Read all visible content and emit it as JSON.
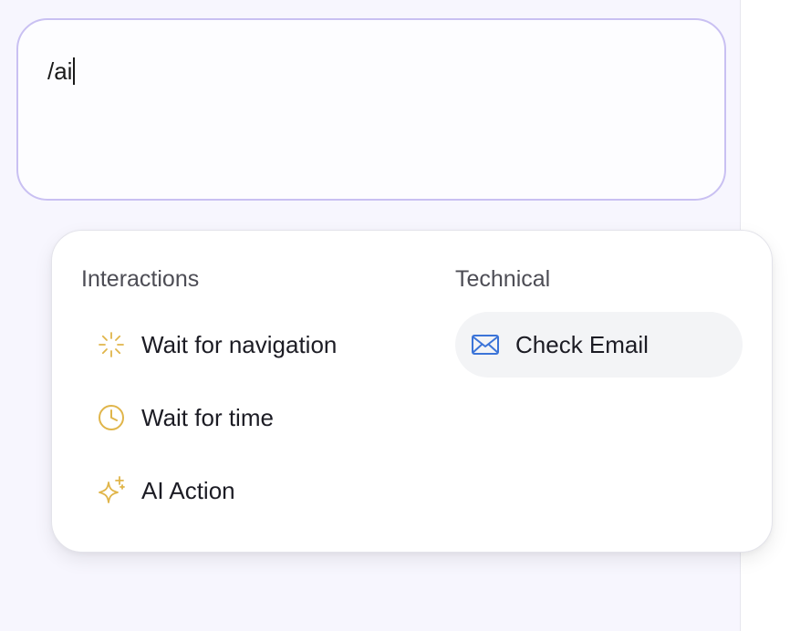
{
  "editor": {
    "value": "/ai"
  },
  "menu": {
    "sections": [
      {
        "heading": "Interactions",
        "items": [
          {
            "label": "Wait for navigation",
            "icon": "loader-icon"
          },
          {
            "label": "Wait for time",
            "icon": "clock-icon"
          },
          {
            "label": "AI Action",
            "icon": "sparkles-icon"
          }
        ]
      },
      {
        "heading": "Technical",
        "items": [
          {
            "label": "Check Email",
            "icon": "mail-icon",
            "highlighted": true
          }
        ]
      }
    ]
  },
  "colors": {
    "panel_background": "#f7f6fe",
    "editor_border": "#c9c0f2",
    "interaction_icon": "#e0b54a",
    "technical_icon": "#3b74d8",
    "highlight_background": "#f3f4f6"
  }
}
